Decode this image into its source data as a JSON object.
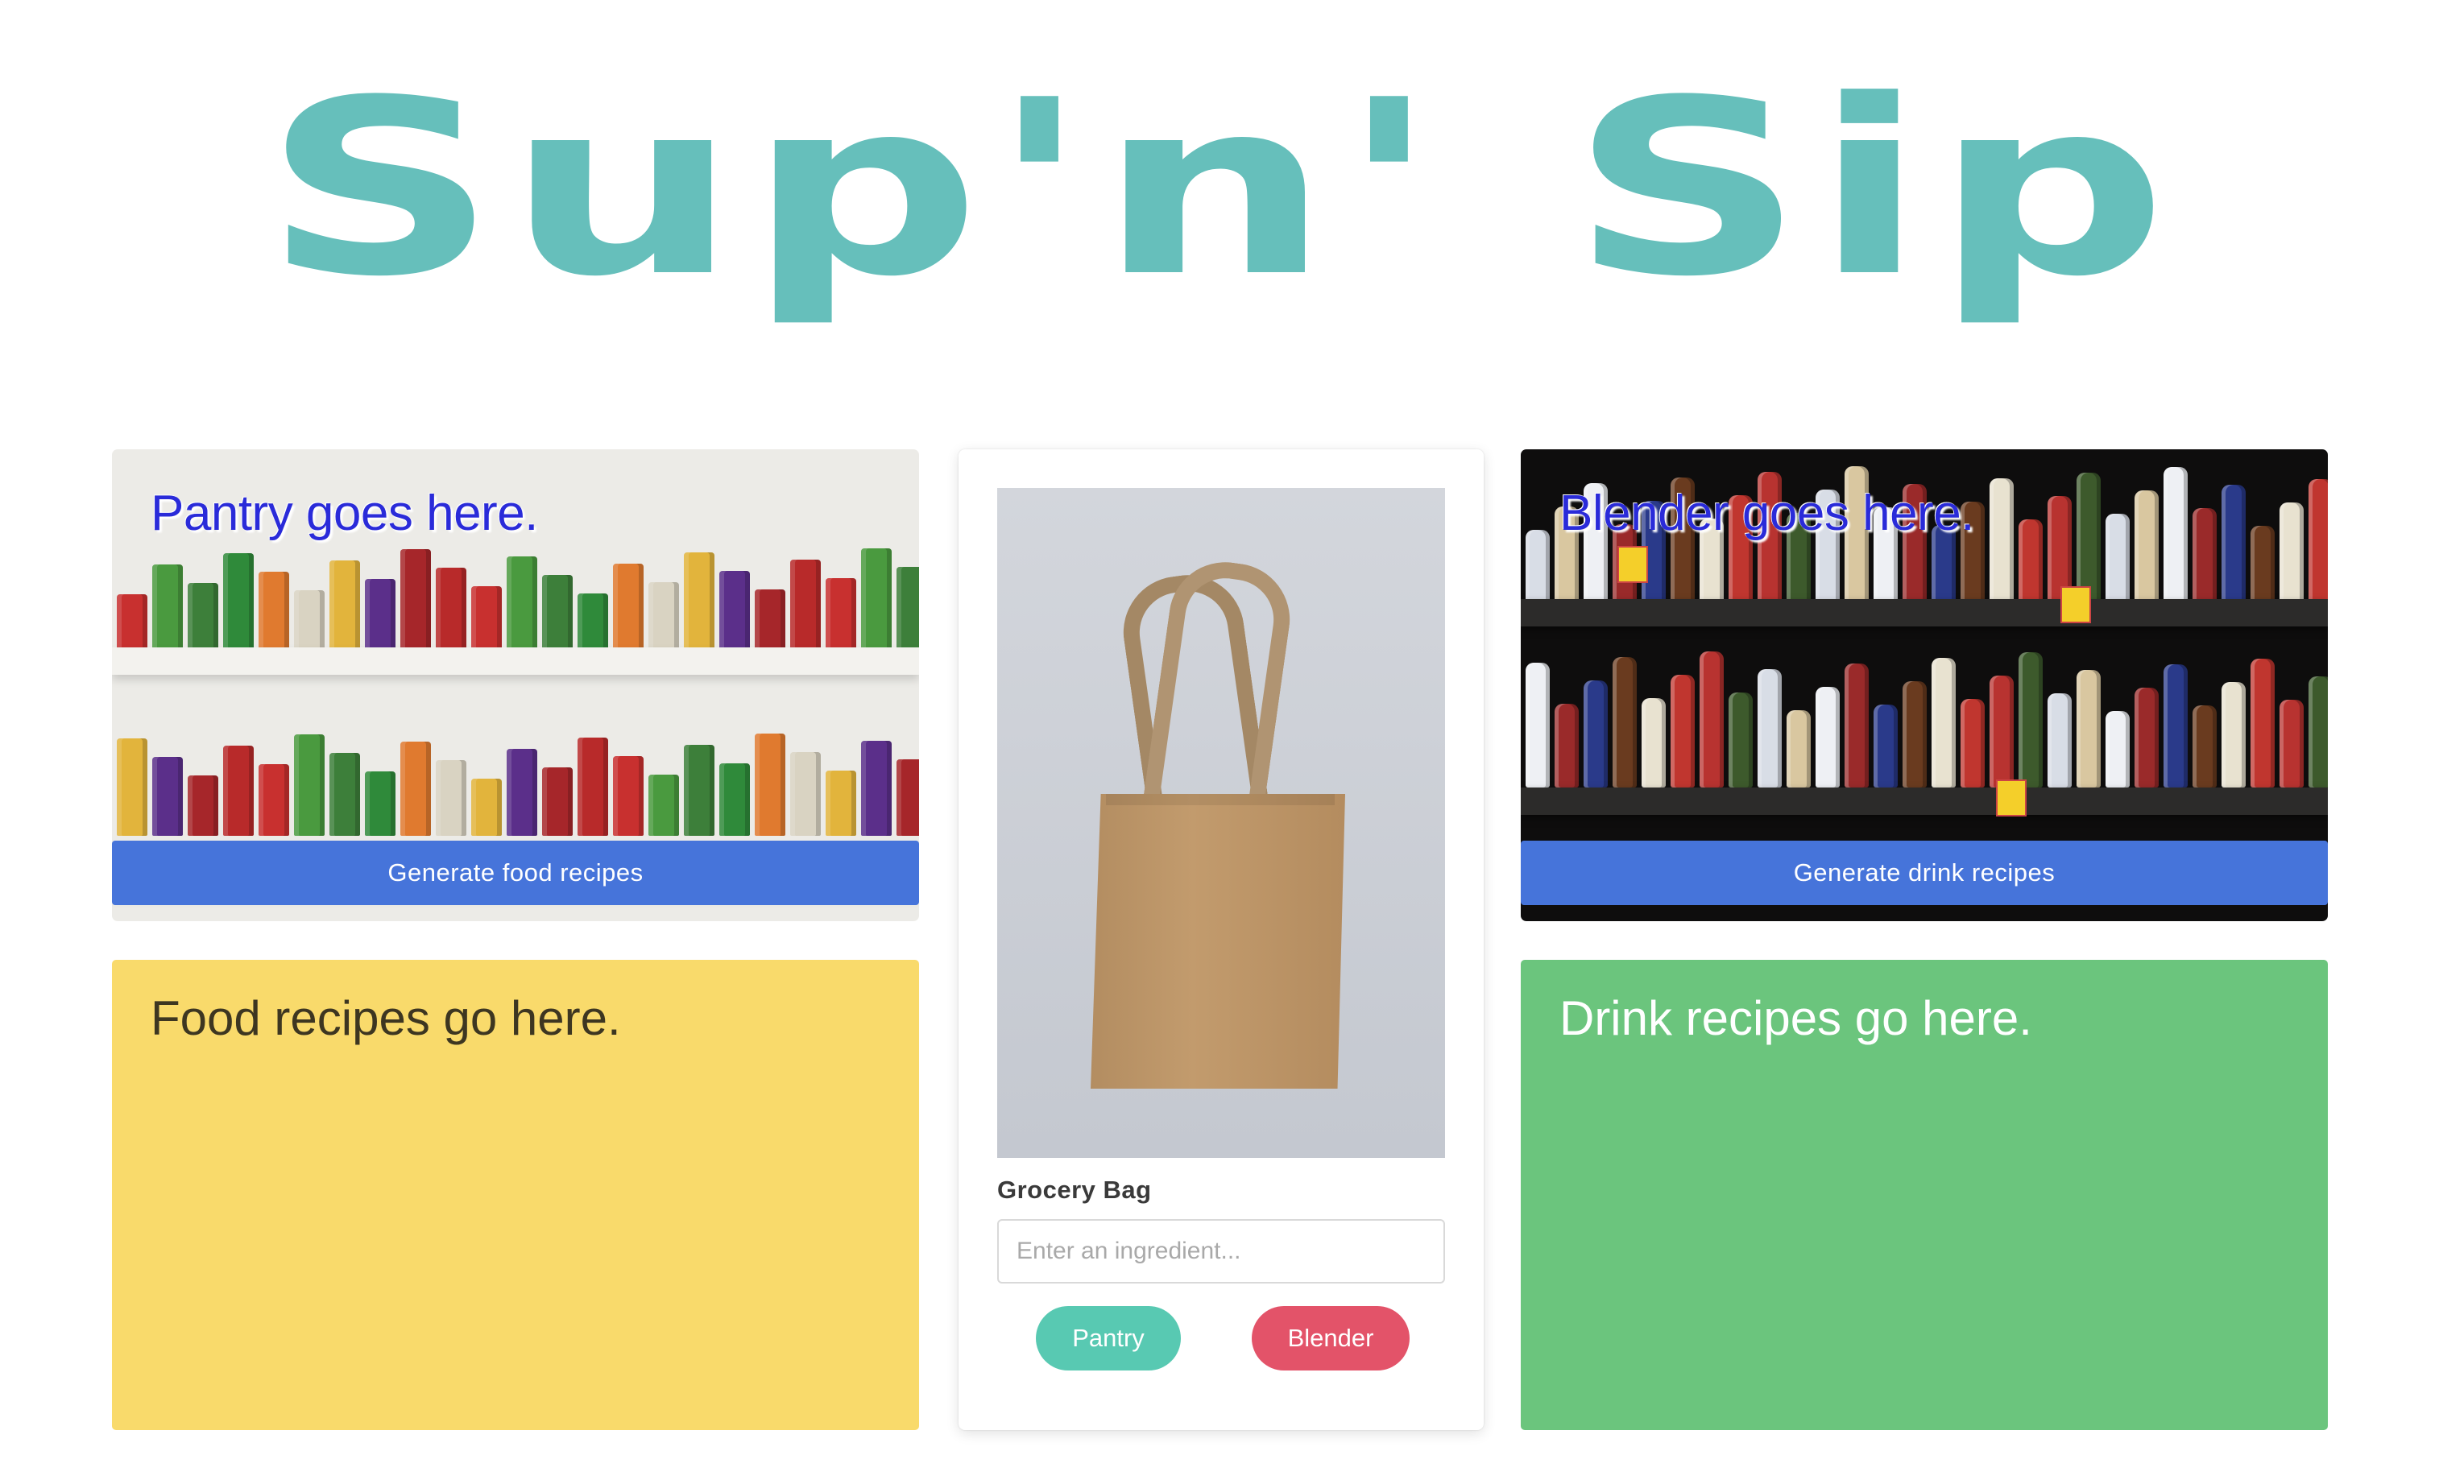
{
  "app": {
    "logo_text": "Sup'n' Sip"
  },
  "pantry": {
    "heading": "Pantry goes here.",
    "generate_label": "Generate food recipes"
  },
  "blender": {
    "heading": "Blender goes here.",
    "generate_label": "Generate drink recipes"
  },
  "grocery_bag": {
    "label": "Grocery Bag",
    "input_placeholder": "Enter an ingredient...",
    "input_value": "",
    "pantry_button": "Pantry",
    "blender_button": "Blender"
  },
  "food_recipes": {
    "heading": "Food recipes go here."
  },
  "drink_recipes": {
    "heading": "Drink recipes go here."
  },
  "colors": {
    "logo": "#66bfbb",
    "generate_button": "#4674da",
    "food_panel": "#f9da6b",
    "drink_panel": "#6bc57d",
    "pantry_pill": "#58c9b2",
    "blender_pill": "#e35369",
    "card_heading": "#2a2bd9"
  },
  "images": {
    "pantry_photo": "pantry-shelves-photo",
    "blender_photo": "liquor-shelves-photo",
    "bag_photo": "tote-bag-photo"
  }
}
